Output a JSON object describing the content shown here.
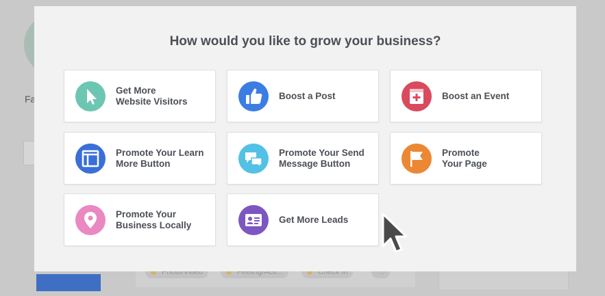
{
  "background": {
    "name_fragment": "Fa",
    "pills": [
      "Photo/Video",
      "Feeling/Acti...",
      "Check In",
      "..."
    ]
  },
  "modal": {
    "title": "How would you like to grow your business?",
    "options": [
      {
        "label": "Get More\nWebsite Visitors",
        "icon": "pointer-icon",
        "color": "#6cc6b2"
      },
      {
        "label": "Boost a Post",
        "icon": "thumbs-up-icon",
        "color": "#3b7de3"
      },
      {
        "label": "Boost an Event",
        "icon": "calendar-plus-icon",
        "color": "#d94a5f"
      },
      {
        "label": "Promote Your Learn\nMore Button",
        "icon": "window-icon",
        "color": "#3a6fd8"
      },
      {
        "label": "Promote Your Send\nMessage Button",
        "icon": "chat-bubbles-icon",
        "color": "#53c1e6"
      },
      {
        "label": "Promote\nYour Page",
        "icon": "flag-icon",
        "color": "#ec8733"
      },
      {
        "label": "Promote Your\nBusiness Locally",
        "icon": "location-pin-icon",
        "color": "#ea88c2"
      },
      {
        "label": "Get More Leads",
        "icon": "contact-card-icon",
        "color": "#7d56c2"
      }
    ]
  }
}
